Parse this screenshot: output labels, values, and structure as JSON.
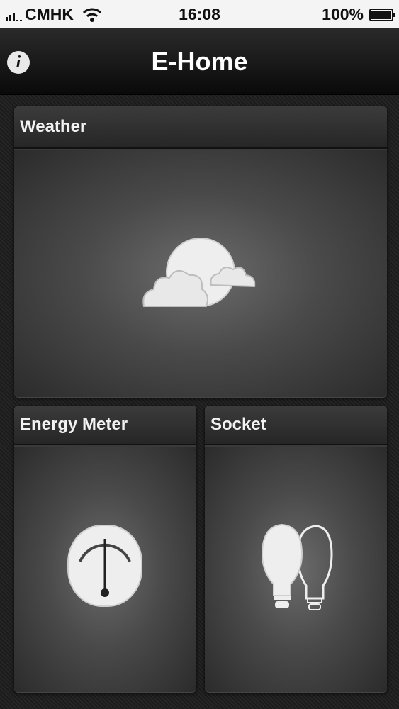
{
  "status_bar": {
    "carrier": "CMHK",
    "time": "16:08",
    "battery": "100%"
  },
  "nav": {
    "title": "E-Home",
    "info_icon": "info-icon"
  },
  "tiles": [
    {
      "label": "Weather",
      "icon": "cloud-moon-icon"
    },
    {
      "label": "Energy Meter",
      "icon": "gauge-icon"
    },
    {
      "label": "Socket",
      "icon": "light-bulb-icon"
    }
  ]
}
